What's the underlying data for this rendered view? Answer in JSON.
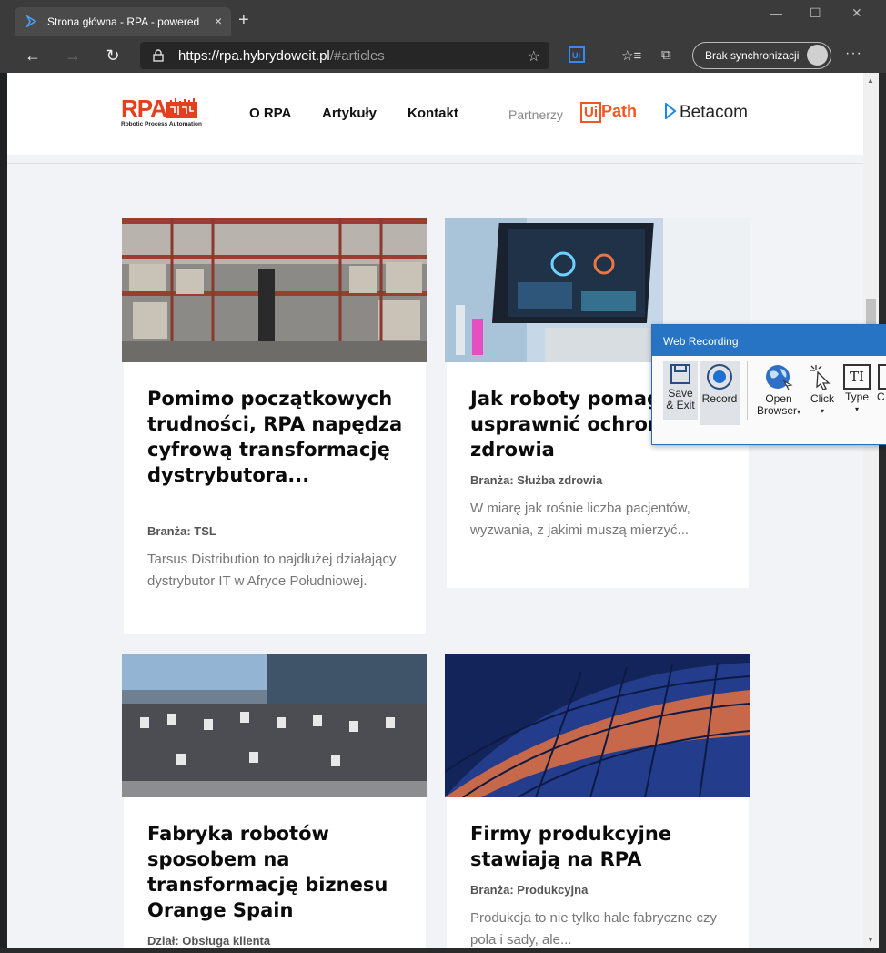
{
  "browser": {
    "tab_title": "Strona główna - RPA - powered",
    "tab_close": "×",
    "new_tab": "+",
    "url_main": "https://rpa.hybrydoweit.pl",
    "url_hash": "/#articles",
    "sync_label": "Brak synchronizacji",
    "window_minimize": "—",
    "window_maximize": "☐",
    "window_close": "✕"
  },
  "site": {
    "logo_text": "RPA",
    "logo_subtitle": "Robotic Process Automation",
    "nav": [
      "O RPA",
      "Artykuły",
      "Kontakt"
    ],
    "partners_label": "Partnerzy",
    "partner_uipath_box": "Ui",
    "partner_uipath_text": "Path",
    "partner_betacom": "Betacom"
  },
  "articles": [
    {
      "title": "Pomimo początkowych trudności, RPA napędza cyfrową transformację dystrybutora...",
      "meta": "Branża: TSL",
      "desc": "Tarsus Distribution to najdłużej działający dystrybutor IT w Afryce Południowej."
    },
    {
      "title": "Jak roboty pomagają usprawnić ochronę zdrowia",
      "meta": "Branża: Służba zdrowia",
      "desc": "W miarę jak rośnie liczba pacjentów, wyzwania, z jakimi muszą mierzyć..."
    },
    {
      "title": "Fabryka robotów sposobem na transformację biznesu Orange Spain",
      "meta": "Dział: Obsługa klienta",
      "desc": ""
    },
    {
      "title": "Firmy produkcyjne stawiają na RPA",
      "meta": "Branża: Produkcyjna",
      "desc": "Produkcja to nie tylko hale fabryczne czy pola i sady, ale..."
    }
  ],
  "web_recording": {
    "title": "Web Recording",
    "buttons": {
      "save_exit_1": "Save",
      "save_exit_2": "& Exit",
      "record": "Record",
      "open_browser_1": "Open",
      "open_browser_2": "Browser",
      "click": "Click",
      "type": "Type",
      "type_icon": "TI",
      "cut": "C"
    }
  }
}
